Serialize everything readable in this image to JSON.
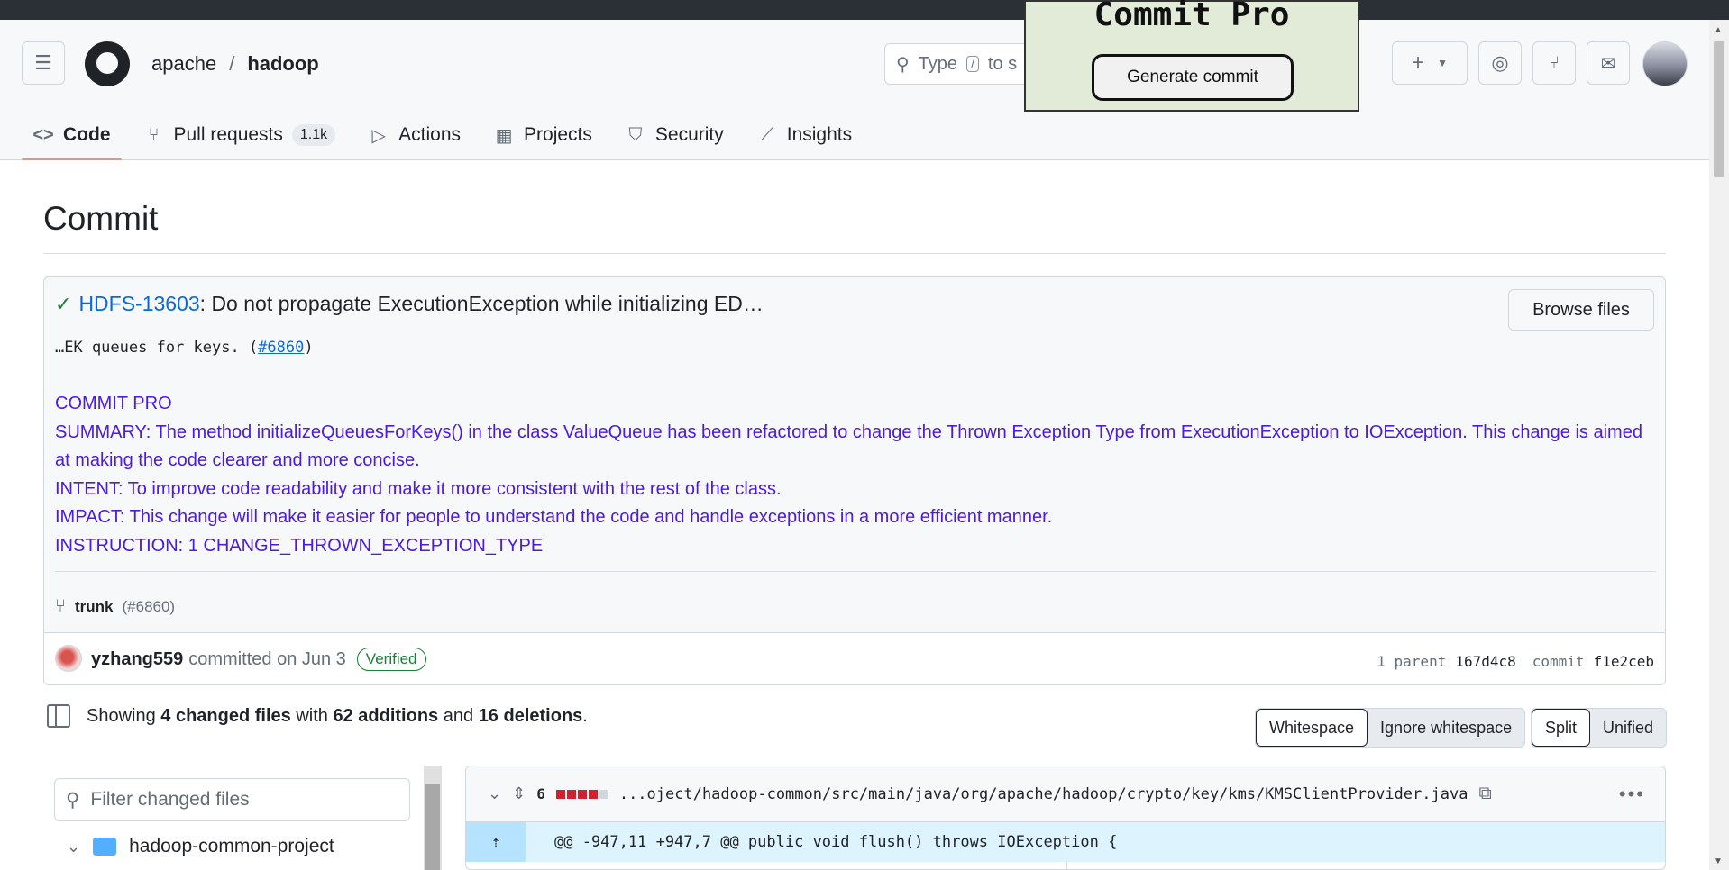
{
  "repo": {
    "owner": "apache",
    "separator": "/",
    "name": "hadoop"
  },
  "search": {
    "prefix": "Type",
    "key": "/",
    "suffix": "to s"
  },
  "popup": {
    "title": "Commit Pro",
    "button": "Generate commit"
  },
  "tabs": [
    {
      "label": "Code",
      "icon": "code-icon"
    },
    {
      "label": "Pull requests",
      "icon": "pull-request-icon",
      "counter": "1.1k"
    },
    {
      "label": "Actions",
      "icon": "play-icon"
    },
    {
      "label": "Projects",
      "icon": "table-icon"
    },
    {
      "label": "Security",
      "icon": "shield-icon"
    },
    {
      "label": "Insights",
      "icon": "graph-icon"
    }
  ],
  "page_title": "Commit",
  "commit": {
    "issue_link": "HDFS-13603",
    "title_rest": ": Do not propagate ExecutionException while initializing ED…",
    "browse_files": "Browse files",
    "body_prefix": "…EK queues for keys. (",
    "body_link": "#6860",
    "body_suffix": ")",
    "commit_pro_lines": [
      "COMMIT PRO",
      "SUMMARY: The method initializeQueuesForKeys() in the class ValueQueue has been refactored to change the Thrown Exception Type from ExecutionException to IOException. This change is aimed at making the code clearer and more concise.",
      "INTENT: To improve code readability and make it more consistent with the rest of the class.",
      "IMPACT: This change will make it easier for people to understand the code and handle exceptions in a more efficient manner.",
      "INSTRUCTION: 1 CHANGE_THROWN_EXCEPTION_TYPE"
    ],
    "branch": "trunk",
    "branch_pr": "(#6860)",
    "author": "yzhang559",
    "committed_on": "committed on Jun 3",
    "verified": "Verified",
    "parent_label": "1 parent",
    "parent_sha": "167d4c8",
    "commit_label": "commit",
    "commit_sha": "f1e2ceb"
  },
  "summary": {
    "showing": "Showing",
    "changed_files": "4 changed files",
    "with": "with",
    "additions": "62 additions",
    "and": "and",
    "deletions": "16 deletions",
    "end": "."
  },
  "whitespace_toggle": {
    "on": "Whitespace",
    "off": "Ignore whitespace"
  },
  "view_toggle": {
    "split": "Split",
    "unified": "Unified"
  },
  "file_filter": {
    "placeholder": "Filter changed files"
  },
  "file_tree": {
    "folder": "hadoop-common-project"
  },
  "diff": {
    "changes": "6",
    "path": "...oject/hadoop-common/src/main/java/org/apache/hadoop/crypto/key/kms/KMSClientProvider.java",
    "hunk": "@@ -947,11 +947,7 @@ public void flush() throws IOException {"
  }
}
